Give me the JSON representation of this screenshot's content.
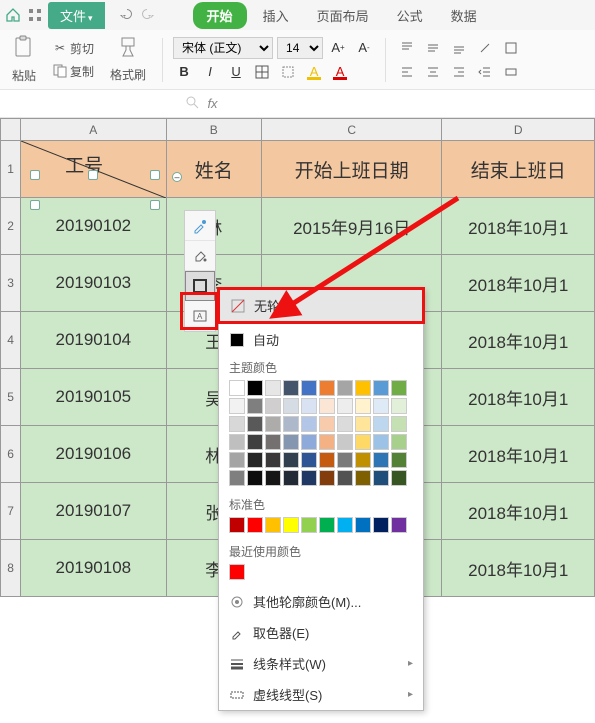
{
  "menu": {
    "file": "文件",
    "insert": "插入",
    "layout": "页面布局",
    "formula": "公式",
    "data": "数据",
    "start": "开始"
  },
  "ribbon": {
    "paste": "粘贴",
    "cut": "剪切",
    "copy": "复制",
    "format_painter": "格式刷",
    "font_name": "宋体 (正文)",
    "font_size": "14"
  },
  "columns": [
    "A",
    "B",
    "C",
    "D"
  ],
  "header": {
    "id": "工号",
    "name": "姓名",
    "start": "开始上班日期",
    "end": "结束上班日"
  },
  "rows": [
    {
      "id": "20190102",
      "name": "林",
      "start": "2015年9月16日",
      "end": "2018年10月1"
    },
    {
      "id": "20190103",
      "name": "李",
      "start": "",
      "end": "2018年10月1"
    },
    {
      "id": "20190104",
      "name": "王",
      "start": "日",
      "end": "2018年10月1"
    },
    {
      "id": "20190105",
      "name": "吴",
      "start": "日",
      "end": "2018年10月1"
    },
    {
      "id": "20190106",
      "name": "林",
      "start": "日",
      "end": "2018年10月1"
    },
    {
      "id": "20190107",
      "name": "张",
      "start": "日",
      "end": "2018年10月1"
    },
    {
      "id": "20190108",
      "name": "李",
      "start": "日",
      "end": "2018年10月1"
    }
  ],
  "popup": {
    "no_outline": "无轮廓",
    "auto": "自动",
    "theme_colors": "主题颜色",
    "standard_colors": "标准色",
    "recent_colors": "最近使用颜色",
    "more_colors": "其他轮廓颜色(M)...",
    "eyedropper": "取色器(E)",
    "line_style": "线条样式(W)",
    "dash_style": "虚线线型(S)"
  },
  "theme_palette": [
    [
      "#ffffff",
      "#000000",
      "#e7e6e6",
      "#44546a",
      "#4472c4",
      "#ed7d31",
      "#a5a5a5",
      "#ffc000",
      "#5b9bd5",
      "#70ad47"
    ],
    [
      "#f2f2f2",
      "#7f7f7f",
      "#d0cece",
      "#d6dce4",
      "#d9e2f3",
      "#fbe5d5",
      "#ededed",
      "#fff2cc",
      "#deebf6",
      "#e2efd9"
    ],
    [
      "#d8d8d8",
      "#595959",
      "#aeabab",
      "#adb9ca",
      "#b4c6e7",
      "#f7cbac",
      "#dbdbdb",
      "#fee599",
      "#bdd7ee",
      "#c5e0b3"
    ],
    [
      "#bfbfbf",
      "#3f3f3f",
      "#757070",
      "#8496b0",
      "#8eaadb",
      "#f4b183",
      "#c9c9c9",
      "#ffd965",
      "#9cc3e5",
      "#a8d08d"
    ],
    [
      "#a5a5a5",
      "#262626",
      "#3a3838",
      "#323f4f",
      "#2f5496",
      "#c55a11",
      "#7b7b7b",
      "#bf9000",
      "#2e75b5",
      "#538135"
    ],
    [
      "#7f7f7f",
      "#0c0c0c",
      "#171616",
      "#222a35",
      "#1f3864",
      "#833c0b",
      "#525252",
      "#7f6000",
      "#1e4e79",
      "#375623"
    ]
  ],
  "standard_palette": [
    "#c00000",
    "#ff0000",
    "#ffc000",
    "#ffff00",
    "#92d050",
    "#00b050",
    "#00b0f0",
    "#0070c0",
    "#002060",
    "#7030a0"
  ],
  "recent_palette": [
    "#ff0000"
  ]
}
